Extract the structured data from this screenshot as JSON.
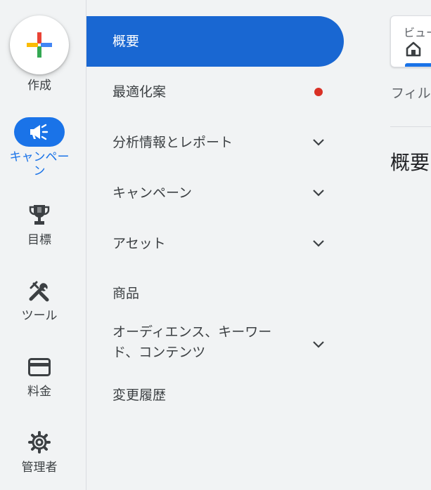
{
  "rail": {
    "create_label": "作成",
    "items": [
      {
        "label": "キャンペーン",
        "icon": "megaphone-icon"
      },
      {
        "label": "目標",
        "icon": "trophy-icon"
      },
      {
        "label": "ツール",
        "icon": "tools-icon"
      },
      {
        "label": "料金",
        "icon": "credit-card-icon"
      },
      {
        "label": "管理者",
        "icon": "gear-icon"
      }
    ]
  },
  "nav": {
    "items": [
      {
        "label": "概要"
      },
      {
        "label": "最適化案"
      },
      {
        "label": "分析情報とレポート"
      },
      {
        "label": "キャンペーン"
      },
      {
        "label": "アセット"
      },
      {
        "label": "商品"
      },
      {
        "label": "オーディエンス、キーワード、コンテンツ"
      },
      {
        "label": "変更履歴"
      }
    ]
  },
  "main": {
    "view_label": "ビュー",
    "filter_label": "フィル",
    "title": "概要"
  },
  "colors": {
    "accent": "#1a73e8",
    "active_nav": "#1967d2",
    "alert_dot": "#d93025"
  }
}
